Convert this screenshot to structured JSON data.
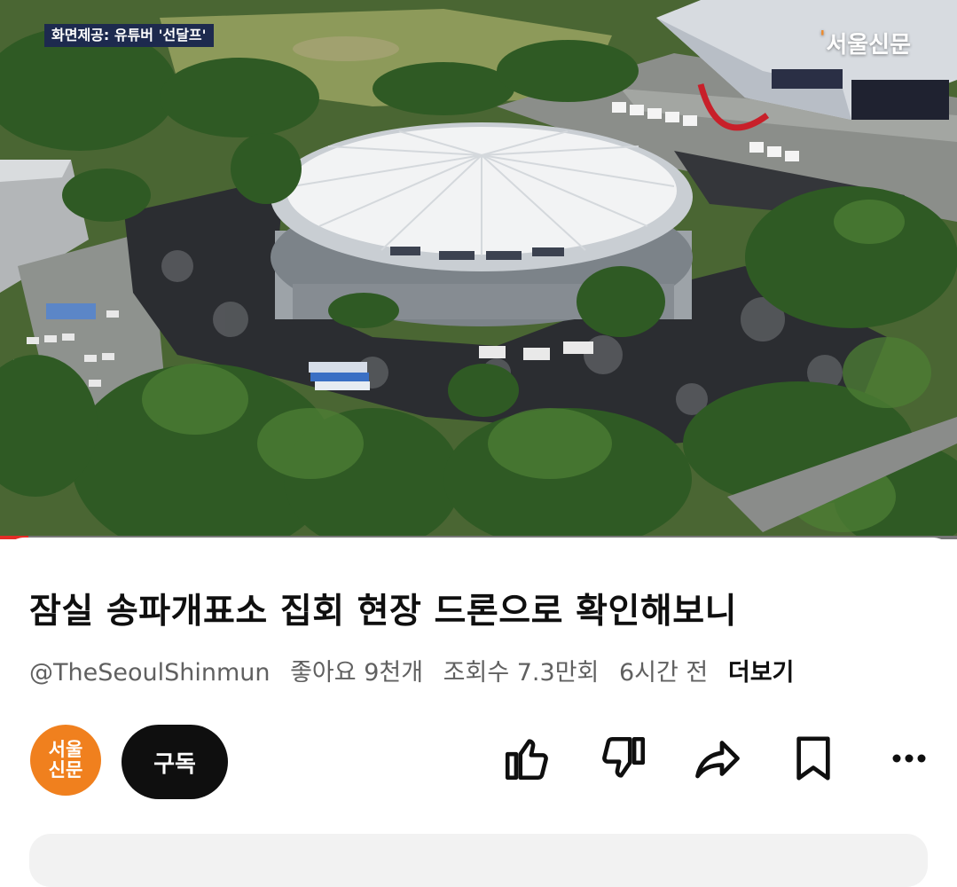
{
  "video": {
    "credit_caption": "화면제공: 유튜버 '선달프'",
    "watermark": "서울신문",
    "progress_fraction": 0.03
  },
  "info": {
    "title": "잠실 송파개표소 집회 현장 드론으로 확인해보니",
    "channel_handle": "@TheSeoulShinmun",
    "likes_text": "좋아요 9천개",
    "views_text": "조회수 7.3만회",
    "time_text": "6시간 전",
    "more_label": "더보기"
  },
  "channel": {
    "avatar_line1": "서울",
    "avatar_line2": "신문",
    "subscribe_label": "구독"
  },
  "actions": [
    "like-icon",
    "dislike-icon",
    "share-icon",
    "save-icon",
    "more-options-icon"
  ],
  "colors": {
    "progress": "#e52d27",
    "avatar_bg": "#f0801e",
    "subscribe_bg": "#0f0f0f",
    "credit_bg": "#1d2a4e"
  }
}
